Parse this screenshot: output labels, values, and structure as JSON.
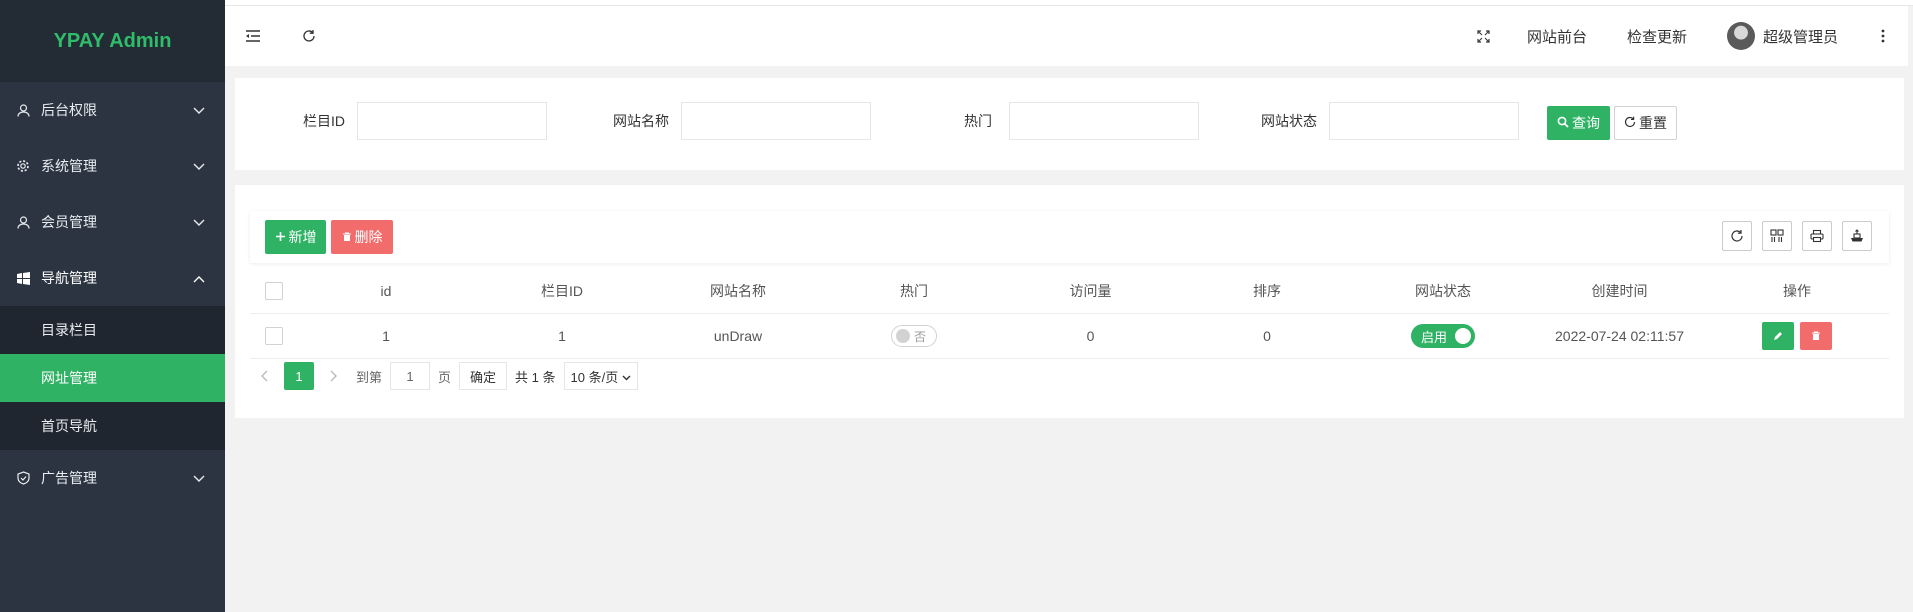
{
  "app": {
    "title": "YPAY Admin"
  },
  "sidebar": {
    "items": [
      {
        "label": "后台权限",
        "icon": "user-icon"
      },
      {
        "label": "系统管理",
        "icon": "gear-icon"
      },
      {
        "label": "会员管理",
        "icon": "user-icon"
      },
      {
        "label": "导航管理",
        "icon": "windows-icon",
        "expanded": true,
        "children": [
          {
            "label": "目录栏目"
          },
          {
            "label": "网址管理",
            "active": true
          },
          {
            "label": "首页导航"
          }
        ]
      },
      {
        "label": "广告管理",
        "icon": "shield-icon"
      }
    ]
  },
  "header": {
    "links": [
      "网站前台",
      "检查更新"
    ],
    "user_name": "超级管理员"
  },
  "search": {
    "fields": [
      {
        "label": "栏目ID",
        "value": ""
      },
      {
        "label": "网站名称",
        "value": ""
      },
      {
        "label": "热门",
        "value": ""
      },
      {
        "label": "网站状态",
        "value": ""
      }
    ],
    "query_label": "查询",
    "reset_label": "重置"
  },
  "toolbar": {
    "add_label": "新增",
    "delete_label": "删除"
  },
  "table": {
    "columns": [
      "id",
      "栏目ID",
      "网站名称",
      "热门",
      "访问量",
      "排序",
      "网站状态",
      "创建时间",
      "操作"
    ],
    "rows": [
      {
        "id": "1",
        "category_id": "1",
        "name": "unDraw",
        "hot": "否",
        "visits": "0",
        "sort": "0",
        "status": "启用",
        "created": "2022-07-24 02:11:57"
      }
    ]
  },
  "pagination": {
    "current": "1",
    "goto_label": "到第",
    "goto_value": "1",
    "page_label": "页",
    "confirm_label": "确定",
    "total_label": "共 1 条",
    "page_size": "10 条/页"
  },
  "colors": {
    "primary": "#2fb264",
    "danger": "#f36c6c",
    "sidebar_bg": "#2b3440",
    "logo_color": "#2fbd6a"
  }
}
